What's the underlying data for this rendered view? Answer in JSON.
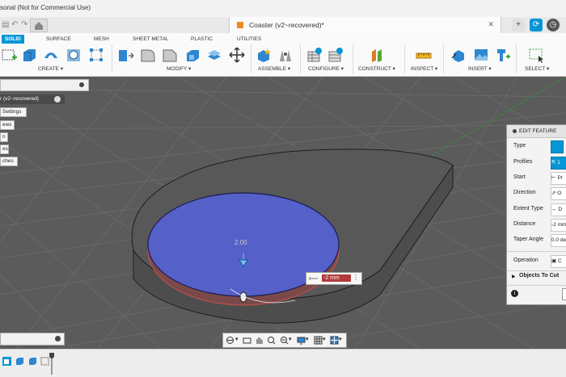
{
  "titlebar": {
    "app_title": "sonal (Not for Commercial Use)"
  },
  "document": {
    "title": "Coaster (v2~recovered)*",
    "close": "✕"
  },
  "workspace_tabs": [
    "SOLID",
    "SURFACE",
    "MESH",
    "SHEET METAL",
    "PLASTIC",
    "UTILITIES"
  ],
  "toolbar_groups": [
    "CREATE ▾",
    "MODIFY ▾",
    "ASSEMBLE ▾",
    "CONFIGURE ▾",
    "CONSTRUCT ▾",
    "INSPECT ▾",
    "INSERT ▾",
    "SELECT ▾"
  ],
  "browser": {
    "root": "r (v2~recovered)",
    "items": [
      "Settings",
      "ews",
      "n",
      "es",
      "ches"
    ]
  },
  "dimension": {
    "label": "2.00",
    "input_value": "-2 mm"
  },
  "edit_feature": {
    "title": "EDIT FEATURE",
    "rows": [
      {
        "label": "Type",
        "value": ""
      },
      {
        "label": "Profiles",
        "value": "1"
      },
      {
        "label": "Start",
        "value": "Pr"
      },
      {
        "label": "Direction",
        "value": "O"
      },
      {
        "label": "Extent Type",
        "value": "D"
      },
      {
        "label": "Distance",
        "value": "-2 mm"
      },
      {
        "label": "Taper Angle",
        "value": "0.0 de"
      },
      {
        "label": "Operation",
        "value": "C"
      }
    ],
    "objects_to_cut": "Objects To Cut"
  },
  "colors": {
    "accent": "#0696d7",
    "profile_fill": "#5561c9",
    "cut_edge": "#c0504d",
    "grid": "#6a6a6a"
  }
}
